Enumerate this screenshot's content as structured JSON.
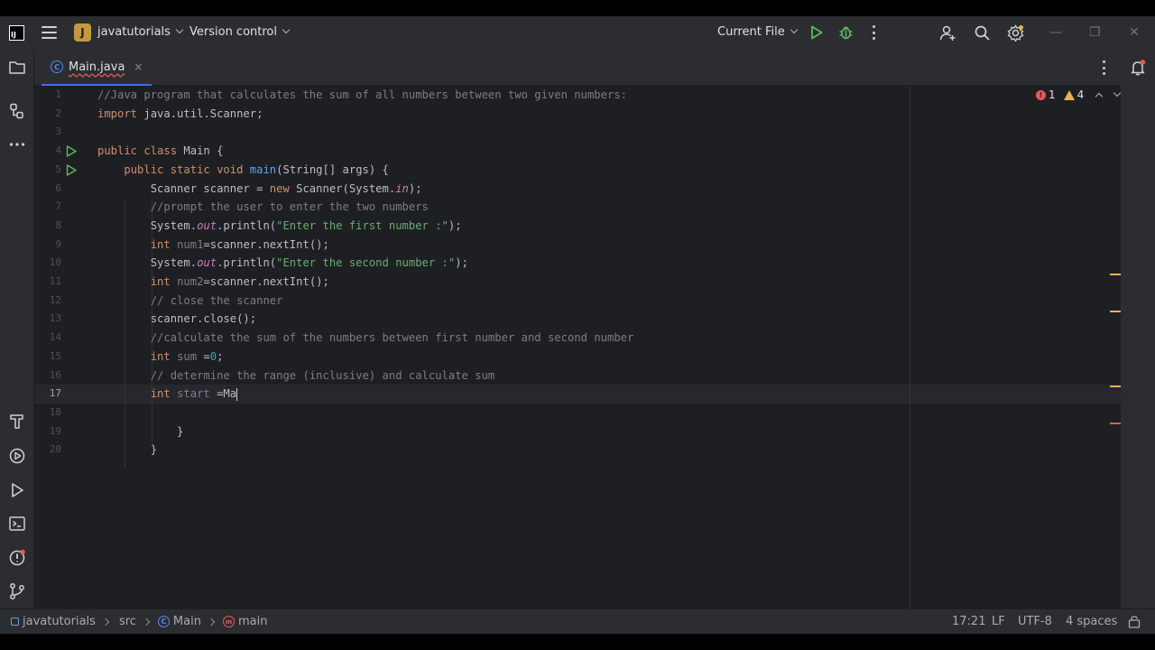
{
  "titlebar": {
    "project_letter": "J",
    "project_name": "javatutorials",
    "vcs_label": "Version control",
    "run_config": "Current File"
  },
  "tab": {
    "label": "Main.java",
    "close": "×"
  },
  "inspections": {
    "errors": "1",
    "warnings": "4"
  },
  "editor": {
    "line_numbers": [
      "1",
      "2",
      "3",
      "4",
      "5",
      "6",
      "7",
      "8",
      "9",
      "10",
      "11",
      "12",
      "13",
      "14",
      "15",
      "16",
      "17",
      "18",
      "19",
      "20"
    ],
    "current_line": 17
  },
  "statusbar": {
    "project": "javatutorials",
    "folder": "src",
    "class": "Main",
    "method": "main",
    "position": "17:21",
    "line_sep": "LF",
    "encoding": "UTF-8",
    "indent": "4 spaces"
  },
  "colors": {
    "accent": "#3574f0",
    "error": "#e55a5a",
    "warning": "#e6b450",
    "run_green": "#5fb865"
  }
}
